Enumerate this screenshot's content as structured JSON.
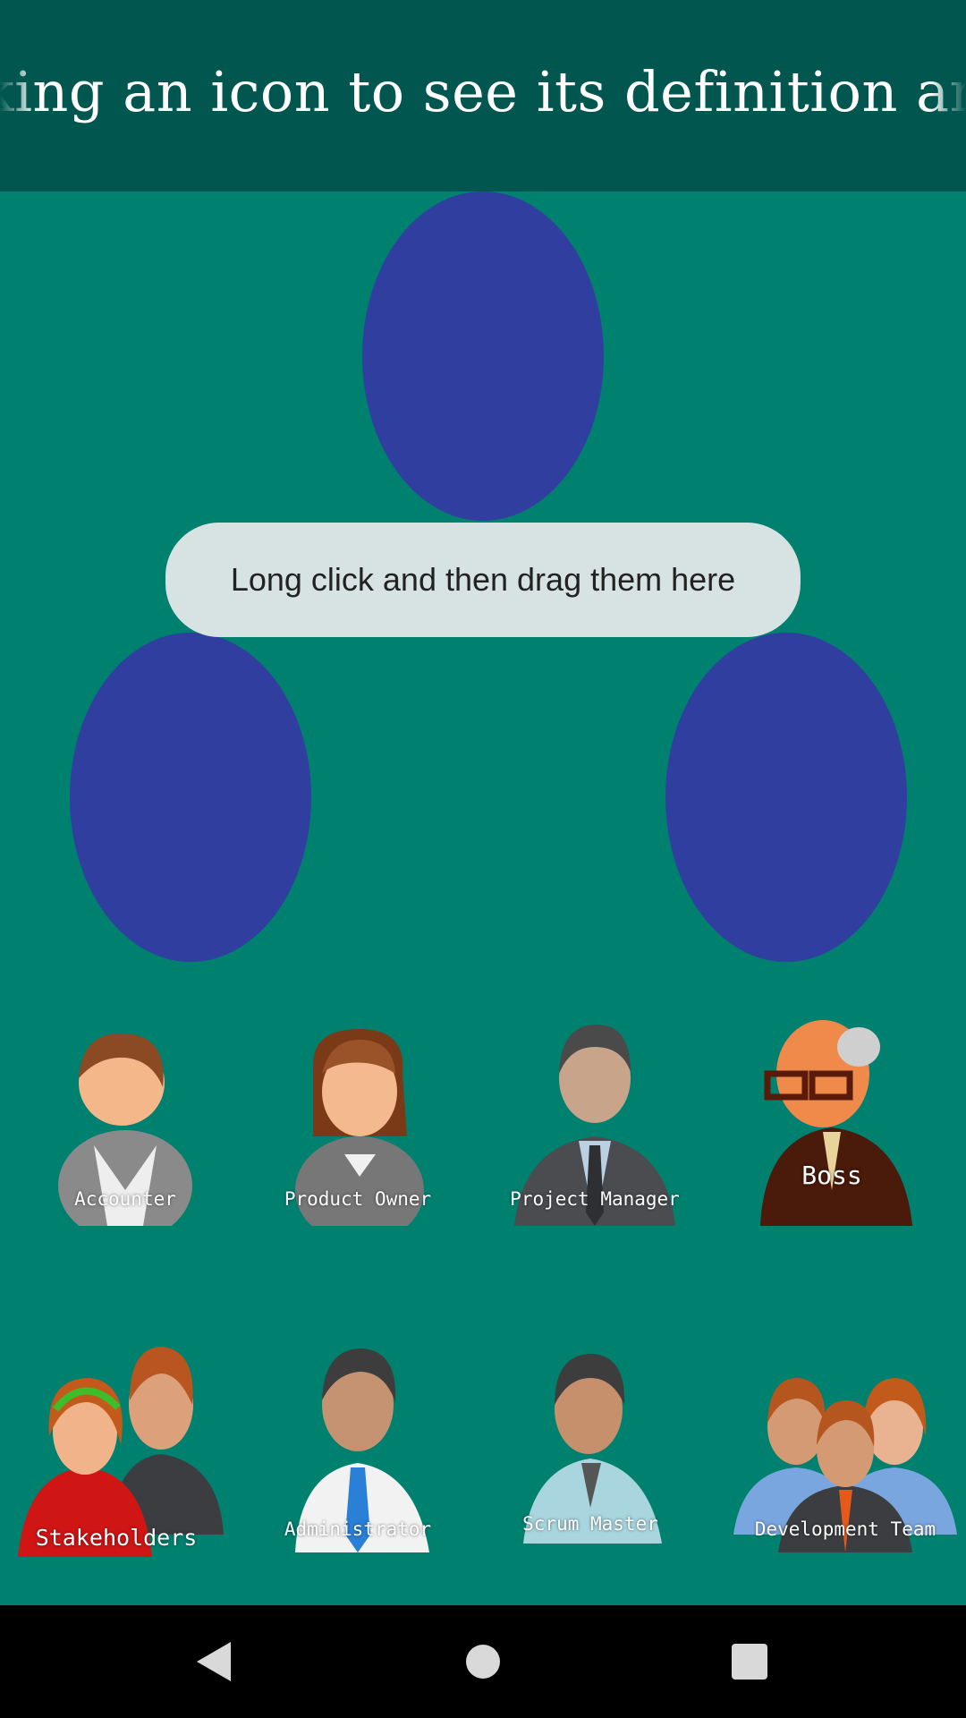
{
  "header": {
    "marquee_text": "king an icon to see its definition and drag"
  },
  "hint": {
    "text": "Long click and then drag them here"
  },
  "roles_row1": [
    {
      "label": "Accounter"
    },
    {
      "label": "Product Owner"
    },
    {
      "label": "Project Manager"
    },
    {
      "label": "Boss"
    }
  ],
  "roles_row2": [
    {
      "label": "Stakeholders"
    },
    {
      "label": "Administrator"
    },
    {
      "label": "Scrum Master"
    },
    {
      "label": "Development Team"
    }
  ],
  "colors": {
    "background": "#00806f",
    "appbar": "#01574f",
    "drop_slot": "#303f9f",
    "hint_bg": "#d7e3e3"
  },
  "navbar": {
    "icons": [
      "back-icon",
      "home-icon",
      "recents-icon"
    ]
  }
}
